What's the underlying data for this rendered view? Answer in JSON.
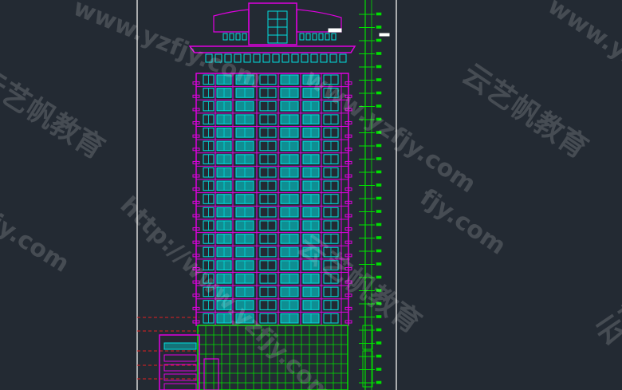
{
  "canvas": {
    "background": "#232a33",
    "frame_line_color": "#d8d8d8",
    "colors": {
      "magenta": "#e000e0",
      "cyan": "#00e0e0",
      "green": "#00e000",
      "red": "#e02020",
      "white": "#ffffff"
    }
  },
  "building": {
    "floors": 19,
    "podium_floors": 2
  },
  "watermarks": {
    "url": "www.yzfjy.com",
    "url_full": "http://www.yzfjy.com",
    "brand": "云艺帆教育",
    "fragment": "fjy.com"
  }
}
